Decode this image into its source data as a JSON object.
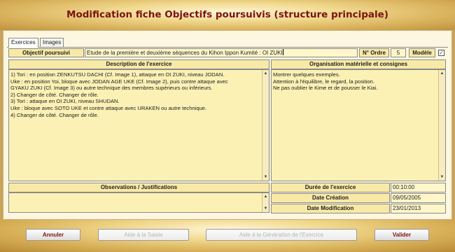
{
  "window": {
    "title": "Modification fiche Objectifs poursuivis (structure principale)"
  },
  "tabs": [
    {
      "label": "Exercices"
    },
    {
      "label": "Images"
    }
  ],
  "header_row": {
    "objectif_label": "Objectif poursuivi",
    "objectif_value": "Etude de la première et deuxième séquences du Kihon Ippon Kumité : OI ZUKI",
    "ordre_label": "N° Ordre",
    "ordre_value": "5",
    "modele_label": "Modèle",
    "modele_checked": true
  },
  "description": {
    "header": "Description de l'exercice",
    "lines": [
      "1) Tori : en position ZENKUTSU DACHI (Cf. Image 1), attaque en OI  ZUKI, niveau JODAN.",
      "Uke : en position Yoi, bloque avec JODAN AGE UKE (Cf. Image 2), puis contre attaque avec",
      "GYAKU ZUKI (Cf. Image 3) ou autre technique des membres supérieurs ou inférieurs.",
      "2) Changer de côté. Changer de rôle.",
      "3) Tori : attaque en OI ZUKI, niveau SHUDAN.",
      "Uke : bloque avec SOTO UKE et contre attaque avec URAKEN ou autre technique.",
      "4) Changer de côté. Changer de rôle."
    ]
  },
  "organisation": {
    "header": "Organisation matérielle et consignes",
    "lines": [
      "Montrer quelques exemples.",
      "Attention à l'équilibre, le regard, la position.",
      "Ne pas oublier le Kime et de pousser le Kiai."
    ]
  },
  "observations": {
    "header": "Observations / Justifications",
    "value": ""
  },
  "meta": {
    "duree_label": "Durée  de l'exercice",
    "duree_value": "00:10:00",
    "creation_label": "Date Création",
    "creation_value": "09/05/2005",
    "modification_label": "Date Modification",
    "modification_value": "23/01/2013"
  },
  "buttons": {
    "annuler": "Annuler",
    "aide_saisie": "Aide à la Saisie",
    "aide_generation": "Aide à la Génération de l'Exercice",
    "valider": "Valider"
  },
  "colors": {
    "title": "#7a1410",
    "field_bg": "#fbf0b0",
    "header_bg": "#f8eaa6"
  }
}
